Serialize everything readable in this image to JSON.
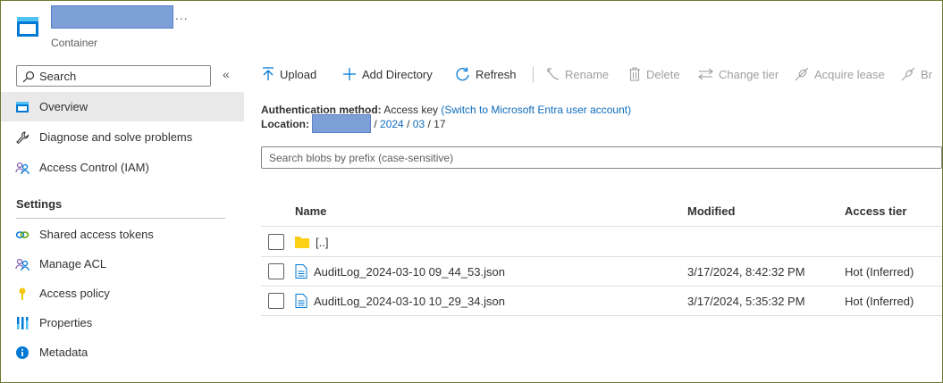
{
  "header": {
    "ellipsis": "...",
    "subtitle": "Container"
  },
  "sidebar": {
    "search_placeholder": "Search",
    "collapse": "«",
    "items": [
      {
        "label": "Overview",
        "icon": "container-icon"
      },
      {
        "label": "Diagnose and solve problems",
        "icon": "wrench-icon"
      },
      {
        "label": "Access Control (IAM)",
        "icon": "people-icon"
      }
    ],
    "settings_title": "Settings",
    "settings_items": [
      {
        "label": "Shared access tokens",
        "icon": "link-icon"
      },
      {
        "label": "Manage ACL",
        "icon": "people-icon"
      },
      {
        "label": "Access policy",
        "icon": "key-icon"
      },
      {
        "label": "Properties",
        "icon": "bars-icon"
      },
      {
        "label": "Metadata",
        "icon": "info-icon"
      }
    ]
  },
  "toolbar": {
    "upload": "Upload",
    "add_directory": "Add Directory",
    "refresh": "Refresh",
    "rename": "Rename",
    "delete": "Delete",
    "change_tier": "Change tier",
    "acquire_lease": "Acquire lease",
    "break_lease": "Br"
  },
  "info": {
    "auth_label": "Authentication method:",
    "auth_value": "Access key",
    "auth_link": "(Switch to Microsoft Entra user account)",
    "location_label": "Location:",
    "sep1": "/",
    "year": "2024",
    "sep2": "/",
    "month": "03",
    "sep3": "/",
    "day": "17"
  },
  "prefix_placeholder": "Search blobs by prefix (case-sensitive)",
  "table": {
    "headers": {
      "name": "Name",
      "modified": "Modified",
      "tier": "Access tier"
    },
    "parent_dir": "[..]",
    "rows": [
      {
        "name": "AuditLog_2024-03-10 09_44_53.json",
        "modified": "3/17/2024, 8:42:32 PM",
        "tier": "Hot (Inferred)"
      },
      {
        "name": "AuditLog_2024-03-10 10_29_34.json",
        "modified": "3/17/2024, 5:35:32 PM",
        "tier": "Hot (Inferred)"
      }
    ]
  },
  "colors": {
    "accent": "#0f6cbd",
    "folder": "#f2c811",
    "redact": "#7c9fd8"
  }
}
